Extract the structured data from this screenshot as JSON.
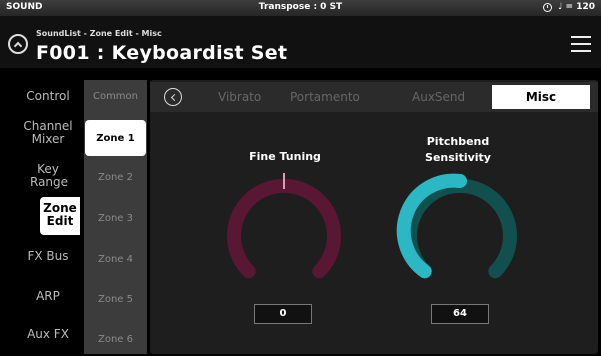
{
  "status": {
    "mode": "SOUND",
    "transpose": "Transpose : 0 ST",
    "tempo": "♩ = 120"
  },
  "header": {
    "breadcrumb": "SoundList - Zone Edit - Misc",
    "title": "F001 : Keyboardist Set"
  },
  "left_nav": {
    "items": [
      {
        "label": "Control"
      },
      {
        "label": "Channel Mixer"
      },
      {
        "label": "Key Range"
      },
      {
        "label": "Zone Edit"
      },
      {
        "label": "FX Bus"
      },
      {
        "label": "ARP"
      },
      {
        "label": "Aux FX"
      }
    ],
    "selected": "Zone Edit"
  },
  "zones": {
    "items": [
      {
        "label": "Common"
      },
      {
        "label": "Zone 1"
      },
      {
        "label": "Zone 2"
      },
      {
        "label": "Zone 3"
      },
      {
        "label": "Zone 4"
      },
      {
        "label": "Zone 5"
      },
      {
        "label": "Zone 6"
      }
    ],
    "selected": "Zone 1"
  },
  "tabs": {
    "items": [
      {
        "label": "Vibrato"
      },
      {
        "label": "Portamento"
      },
      {
        "label": "AuxSend"
      },
      {
        "label": "Misc"
      }
    ],
    "selected": "Misc"
  },
  "knobs": [
    {
      "label": "Fine Tuning",
      "value": "0",
      "color": "#9c1c52",
      "track": "#5a1733"
    },
    {
      "label": "Pitchbend Sensitivity",
      "value": "64",
      "color": "#2bb7c4",
      "track": "#12504f"
    }
  ],
  "colors": {
    "panel": "#1e1e1e",
    "zone_column": "#3c3c3c",
    "accent": "#ffffff"
  }
}
